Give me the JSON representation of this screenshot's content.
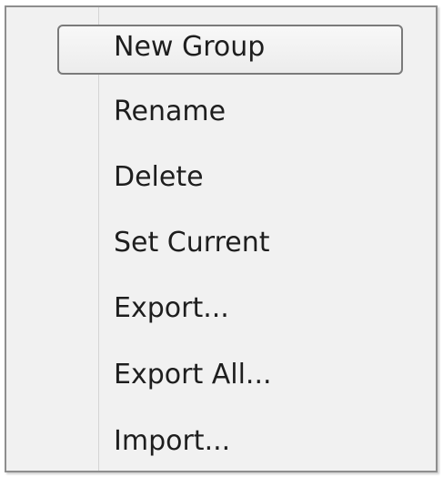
{
  "context_menu": {
    "items": [
      {
        "label": "New Group",
        "highlighted": true
      },
      {
        "label": "Rename"
      },
      {
        "label": "Delete"
      },
      {
        "label": "Set Current"
      },
      {
        "label": "Export..."
      },
      {
        "label": "Export All..."
      },
      {
        "label": "Import..."
      }
    ]
  }
}
